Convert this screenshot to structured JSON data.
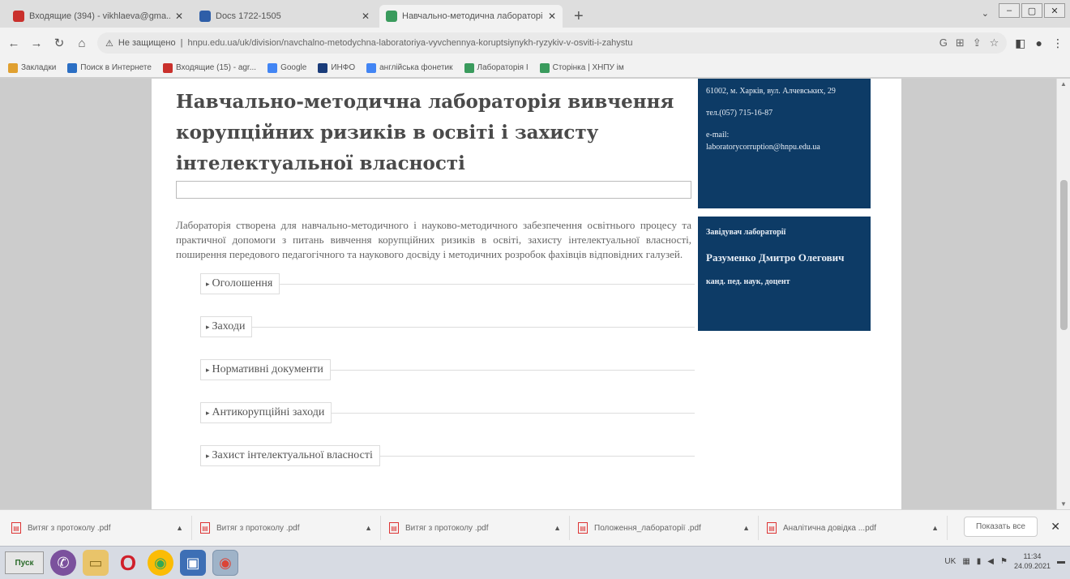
{
  "browser": {
    "tabs": [
      {
        "title": "Входящие (394) - vikhlaeva@gma...",
        "color": "#c9302c",
        "active": false
      },
      {
        "title": "Docs 1722-1505",
        "color": "#2e5ea8",
        "active": false
      },
      {
        "title": "Навчально-методична лабораторі...",
        "color": "#3a9b5d",
        "active": true
      }
    ],
    "new_tab_label": "+",
    "window_controls": [
      "–",
      "▢",
      "✕"
    ],
    "tab_menu": "⌄",
    "address": {
      "security_label": "Не защищено",
      "url": "hnpu.edu.ua/uk/division/navchalno-metodychna-laboratoriya-vyvchennya-koruptsiynykh-ryzykiv-v-osviti-i-zahystu"
    },
    "bookmarks": [
      {
        "label": "Закладки",
        "color": "#e0a030"
      },
      {
        "label": "Поиск в Интернете",
        "color": "#2b6fc4"
      },
      {
        "label": "Входящие (15) - agr...",
        "color": "#c9302c"
      },
      {
        "label": "Google",
        "color": "#4285f4"
      },
      {
        "label": "ИНФО",
        "color": "#1a3c7a"
      },
      {
        "label": "англійська фонетик",
        "color": "#4285f4"
      },
      {
        "label": "Лабораторія І",
        "color": "#3a9b5d"
      },
      {
        "label": "Сторінка | ХНПУ ім",
        "color": "#3a9b5d"
      }
    ]
  },
  "page": {
    "title": "Навчально-методична лабораторія вивчення корупційних ризиків в освіті і захисту інтелектуальної власності",
    "intro": "Лабораторія створена для навчально-методичного і науково-методичного забезпечення освітнього процесу та практичної допомоги з питань вивчення корупційних ризиків в освіті, захисту інтелектуальної власності, поширення передового педагогічного та наукового досвіду і методичних розробок фахівців відповідних галузей.",
    "sections": [
      {
        "label": "Оголошення"
      },
      {
        "label": "Заходи"
      },
      {
        "label": "Нормативні документи"
      },
      {
        "label": "Антикорупційні заходи"
      },
      {
        "label": "Захист інтелектуальної власності"
      }
    ],
    "contact": {
      "address": "61002, м. Харків, вул. Алчевських, 29",
      "phone": "тел.(057) 715-16-87",
      "email_label": "e-mail:",
      "email": "laboratorycorruption@hnpu.edu.ua"
    },
    "head": {
      "role": "Завідувач лабораторії",
      "name": "Разуменко Дмитро Олегович",
      "degree": "канд. пед. наук, доцент"
    }
  },
  "downloads": {
    "items": [
      {
        "name": "Витяг з протоколу .pdf"
      },
      {
        "name": "Витяг з протоколу .pdf"
      },
      {
        "name": "Витяг з протоколу .pdf"
      },
      {
        "name": "Положення_лабораторії .pdf"
      },
      {
        "name": "Аналітична довідка ...pdf"
      }
    ],
    "show_all": "Показать все",
    "close": "✕"
  },
  "taskbar": {
    "start_label": "Пуск",
    "tray_lang": "UK",
    "time": "11:34",
    "date": "24.09.2021"
  }
}
